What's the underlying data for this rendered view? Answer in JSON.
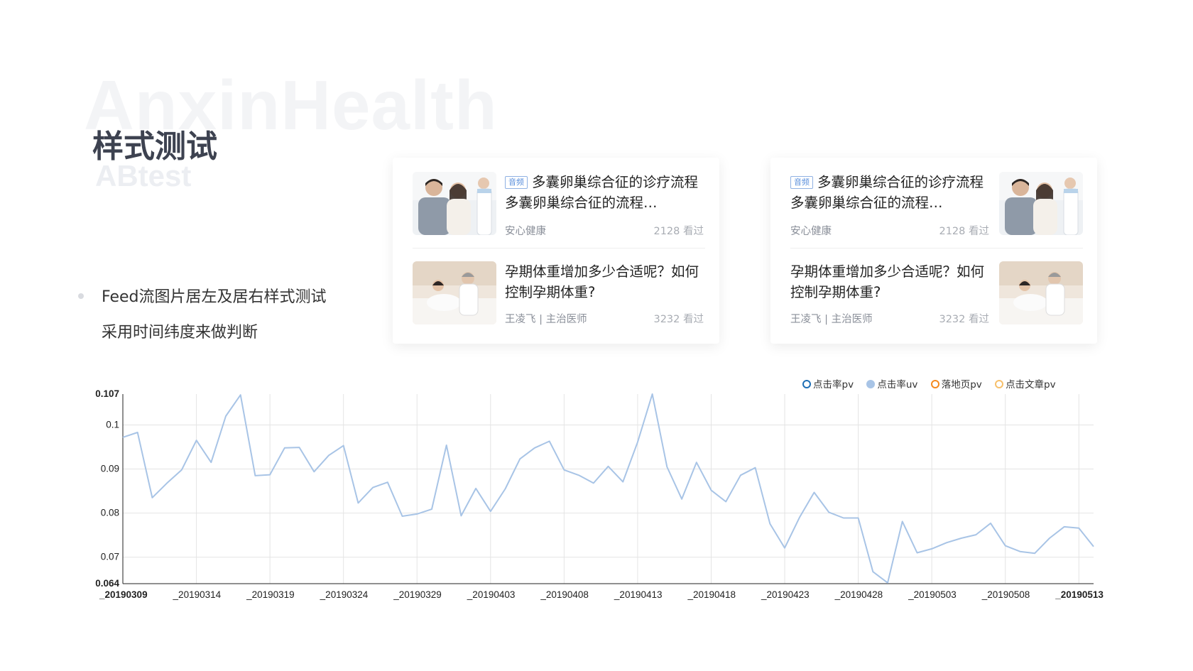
{
  "header": {
    "watermark": "AnxinHealth",
    "title": "样式测试",
    "subtitle": "ABtest"
  },
  "bullets": [
    "Feed流图片居左及居右样式测试",
    "采用时间纬度来做判断"
  ],
  "feed_cards": [
    {
      "image_side": "left",
      "items": [
        {
          "tag": "音频",
          "headline": "多囊卵巢综合征的诊疗流程多囊卵巢综合征的流程…",
          "source": "安心健康",
          "views": "2128 看过",
          "thumb_icon": "couple-with-nurse-image"
        },
        {
          "tag": "",
          "headline": "孕期体重增加多少合适呢？如何控制孕期体重?",
          "source": "王凌飞 | 主治医师",
          "views": "3232 看过",
          "thumb_icon": "doctor-with-pregnant-patient-image"
        }
      ]
    },
    {
      "image_side": "right",
      "items": [
        {
          "tag": "音频",
          "headline": "多囊卵巢综合征的诊疗流程多囊卵巢综合征的流程…",
          "source": "安心健康",
          "views": "2128 看过",
          "thumb_icon": "couple-with-nurse-image"
        },
        {
          "tag": "",
          "headline": "孕期体重增加多少合适呢？如何控制孕期体重?",
          "source": "王凌飞 | 主治医师",
          "views": "3232 看过",
          "thumb_icon": "doctor-with-pregnant-patient-image"
        }
      ]
    }
  ],
  "chart_data": {
    "type": "line",
    "title": "",
    "xlabel": "",
    "ylabel": "",
    "grid": true,
    "legend_position": "top-right",
    "legend": [
      {
        "name": "点击率pv",
        "color": "#1f6fb5",
        "style": "ring"
      },
      {
        "name": "点击率uv",
        "color": "#a8c4e6",
        "style": "filled"
      },
      {
        "name": "落地页pv",
        "color": "#f58a1f",
        "style": "ring"
      },
      {
        "name": "点击文章pv",
        "color": "#f7c06b",
        "style": "ring"
      }
    ],
    "ylim": [
      0.064,
      0.107
    ],
    "y_ticks": [
      "0.064",
      "0.07",
      "0.08",
      "0.09",
      "0.1",
      "0.107"
    ],
    "x_ticks": [
      "_20190309",
      "_20190314",
      "_20190319",
      "_20190324",
      "_20190329",
      "_20190403",
      "_20190408",
      "_20190413",
      "_20190418",
      "_20190423",
      "_20190428",
      "_20190503",
      "_20190508",
      "_20190513"
    ],
    "x_start": "2019-03-09",
    "x_end": "2019-05-15",
    "series": [
      {
        "name": "点击率uv",
        "color": "#a8c4e6",
        "values": [
          0.0972,
          0.0983,
          0.0835,
          0.0868,
          0.0898,
          0.0965,
          0.0915,
          0.102,
          0.1068,
          0.0885,
          0.0887,
          0.0948,
          0.0949,
          0.0894,
          0.0931,
          0.0953,
          0.0823,
          0.0858,
          0.087,
          0.0793,
          0.0798,
          0.0809,
          0.0954,
          0.0794,
          0.0856,
          0.0804,
          0.0855,
          0.0923,
          0.0948,
          0.0963,
          0.0898,
          0.0886,
          0.0868,
          0.0906,
          0.0871,
          0.0961,
          0.107,
          0.0905,
          0.0832,
          0.0915,
          0.0852,
          0.0826,
          0.0886,
          0.0903,
          0.0776,
          0.0721,
          0.079,
          0.0847,
          0.0802,
          0.0789,
          0.0789,
          0.0667,
          0.0642,
          0.0781,
          0.071,
          0.0719,
          0.0733,
          0.0743,
          0.0751,
          0.0777,
          0.0726,
          0.0713,
          0.0709,
          0.0743,
          0.0769,
          0.0766,
          0.0724
        ]
      }
    ]
  }
}
